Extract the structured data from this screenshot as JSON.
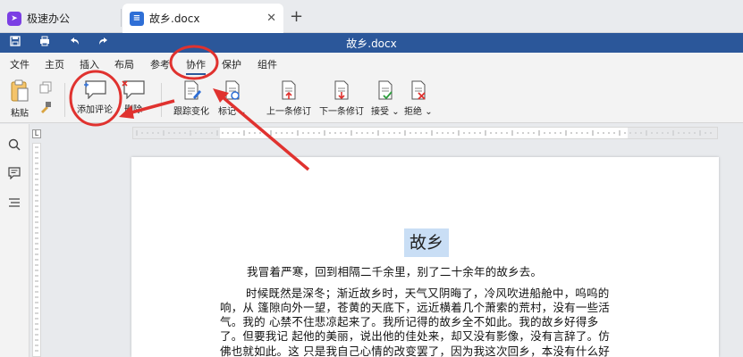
{
  "tabs": {
    "home_label": "极速办公",
    "doc_label": "故乡.docx"
  },
  "titlebar": {
    "title": "故乡.docx"
  },
  "menu": {
    "items": [
      "文件",
      "主页",
      "插入",
      "布局",
      "参考",
      "协作",
      "保护",
      "组件"
    ],
    "active": "协作"
  },
  "ribbon": {
    "paste": "粘贴",
    "add_comment": "添加评论",
    "delete": "删除",
    "track_changes": "跟踪变化",
    "display_mode": "标记",
    "prev_change": "上一条修订",
    "next_change": "下一条修订",
    "accept": "接受",
    "reject": "拒绝"
  },
  "ruler": {
    "corner": "L"
  },
  "document": {
    "heading": "故乡",
    "lines": [
      "我冒着严寒，回到相隔二千余里，别了二十余年的故乡去。",
      "时候既然是深冬；渐近故乡时，天气又阴晦了，冷风吹进船舱中，呜呜的",
      "响，从 篷隙向外一望，苍黄的天底下，远近横着几个萧索的荒村，没有一些活",
      "气。我的 心禁不住悲凉起来了。我所记得的故乡全不如此。我的故乡好得多",
      "了。但要我记 起他的美丽，说出他的佳处来，却又没有影像，没有言辞了。仿",
      "佛也就如此。这 只是我自己心情的改变罢了，因为我这次回乡，本没有什么好"
    ]
  },
  "colors": {
    "titlebar": "#2b579a",
    "annotation": "#e0322f",
    "heading_highlight": "#c9def5"
  }
}
